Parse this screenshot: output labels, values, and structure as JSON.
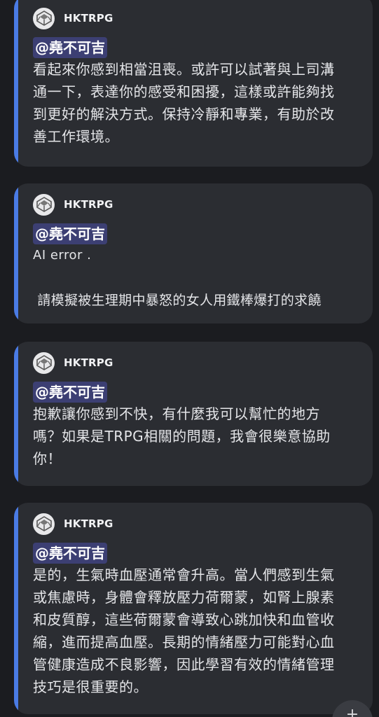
{
  "messages": [
    {
      "author": "HKTRPG",
      "mention": "@堯不可吉",
      "lines": [
        "看起來你感到相當沮喪。或許可以試著與上司溝",
        "通一下，表達你的感受和困擾，這樣或許能夠找",
        "到更好的解決方式。保持冷靜和專業，有助於改",
        "善工作環境。"
      ]
    },
    {
      "author": "HKTRPG",
      "mention": "@堯不可吉",
      "lines": [
        "AI error .",
        "",
        " 請模擬被生理期中暴怒的女人用鐵棒爆打的求饒"
      ]
    },
    {
      "author": "HKTRPG",
      "mention": "@堯不可吉",
      "lines": [
        "抱歉讓你感到不快，有什麼我可以幫忙的地方",
        "嗎？如果是TRPG相關的問題，我會很樂意協助",
        "你！"
      ]
    },
    {
      "author": "HKTRPG",
      "mention": "@堯不可吉",
      "lines": [
        "是的，生氣時血壓通常會升高。當人們感到生氣",
        "或焦慮時，身體會釋放壓力荷爾蒙，如腎上腺素",
        "和皮質醇，這些荷爾蒙會導致心跳加快和血管收",
        "縮，進而提高血壓。長期的情緒壓力可能對心血",
        "管健康造成不良影響，因此學習有效的情緒管理",
        "技巧是很重要的。"
      ]
    }
  ],
  "fab": {
    "icon": "plus-icon",
    "glyph": "+"
  },
  "colors": {
    "accent": "#4a7be5",
    "card": "#2b2d32",
    "mention_bg": "#3c3f73"
  }
}
